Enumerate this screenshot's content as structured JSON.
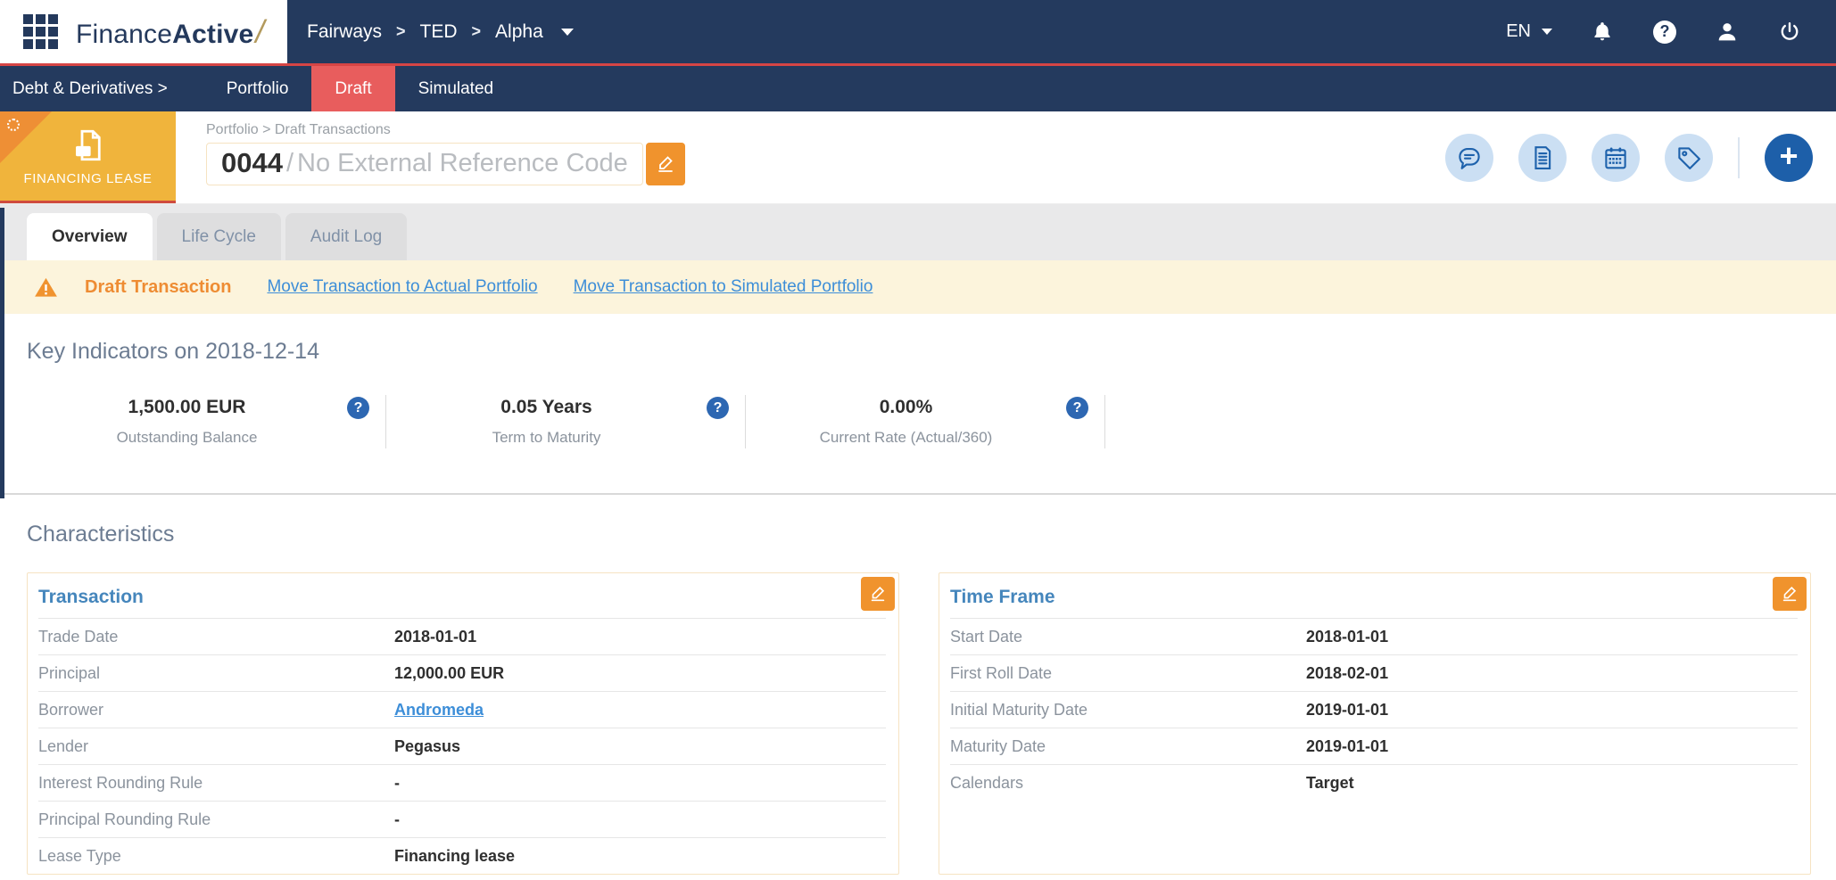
{
  "topnav": {
    "logo": {
      "part1": "Finance",
      "part2": "Active",
      "slash": "/"
    },
    "breadcrumb": {
      "items": [
        "Fairways",
        "TED",
        "Alpha"
      ],
      "separator": ">"
    },
    "language": "EN"
  },
  "subnav": {
    "items": [
      {
        "label": "Debt & Derivatives >"
      },
      {
        "label": "Portfolio"
      },
      {
        "label": "Draft",
        "active": true
      },
      {
        "label": "Simulated"
      }
    ]
  },
  "header": {
    "badge_label": "FINANCING LEASE",
    "breadcrumb": "Portfolio > Draft Transactions",
    "title_number": "0044",
    "title_separator": "/",
    "title_placeholder": "No External Reference Code"
  },
  "tabs": [
    {
      "label": "Overview",
      "active": true
    },
    {
      "label": "Life Cycle",
      "active": false
    },
    {
      "label": "Audit Log",
      "active": false
    }
  ],
  "warning": {
    "label": "Draft Transaction",
    "links": [
      "Move Transaction to Actual Portfolio",
      "Move Transaction to Simulated Portfolio"
    ]
  },
  "key_indicators": {
    "title": "Key Indicators on 2018-12-14",
    "items": [
      {
        "value": "1,500.00 EUR",
        "label": "Outstanding Balance"
      },
      {
        "value": "0.05 Years",
        "label": "Term to Maturity"
      },
      {
        "value": "0.00%",
        "label": "Current Rate (Actual/360)"
      }
    ]
  },
  "characteristics": {
    "title": "Characteristics",
    "transaction": {
      "title": "Transaction",
      "rows": [
        {
          "label": "Trade Date",
          "value": "2018-01-01"
        },
        {
          "label": "Principal",
          "value": "12,000.00 EUR"
        },
        {
          "label": "Borrower",
          "value": "Andromeda",
          "link": true
        },
        {
          "label": "Lender",
          "value": "Pegasus"
        },
        {
          "label": "Interest Rounding Rule",
          "value": "-"
        },
        {
          "label": "Principal Rounding Rule",
          "value": "-"
        },
        {
          "label": "Lease Type",
          "value": "Financing lease"
        }
      ]
    },
    "time_frame": {
      "title": "Time Frame",
      "rows": [
        {
          "label": "Start Date",
          "value": "2018-01-01"
        },
        {
          "label": "First Roll Date",
          "value": "2018-02-01"
        },
        {
          "label": "Initial Maturity Date",
          "value": "2019-01-01"
        },
        {
          "label": "Maturity Date",
          "value": "2019-01-01"
        },
        {
          "label": "Calendars",
          "value": "Target"
        }
      ]
    }
  },
  "icons": {
    "help_glyph": "?",
    "plus_glyph": "+",
    "names": [
      "apps-grid-icon",
      "bell-icon",
      "help-icon",
      "user-icon",
      "power-icon",
      "document-copy-icon",
      "edit-icon",
      "comment-icon",
      "document-icon",
      "calendar-icon",
      "tag-icon",
      "add-icon",
      "warning-icon",
      "question-icon",
      "chevron-down-icon"
    ]
  },
  "colors": {
    "navy": "#243a5e",
    "red_line": "#d64545",
    "active_tab_red": "#e85d5d",
    "badge_yellow": "#f0b43c",
    "orange_button": "#f0932d",
    "warning_bg": "#fcf4dc",
    "warning_text": "#ee8c33",
    "link_blue": "#3d8ed8",
    "card_header_blue": "#4586bc",
    "icon_circle_bg": "#cbdff3",
    "icon_blue": "#1d5fa9"
  }
}
